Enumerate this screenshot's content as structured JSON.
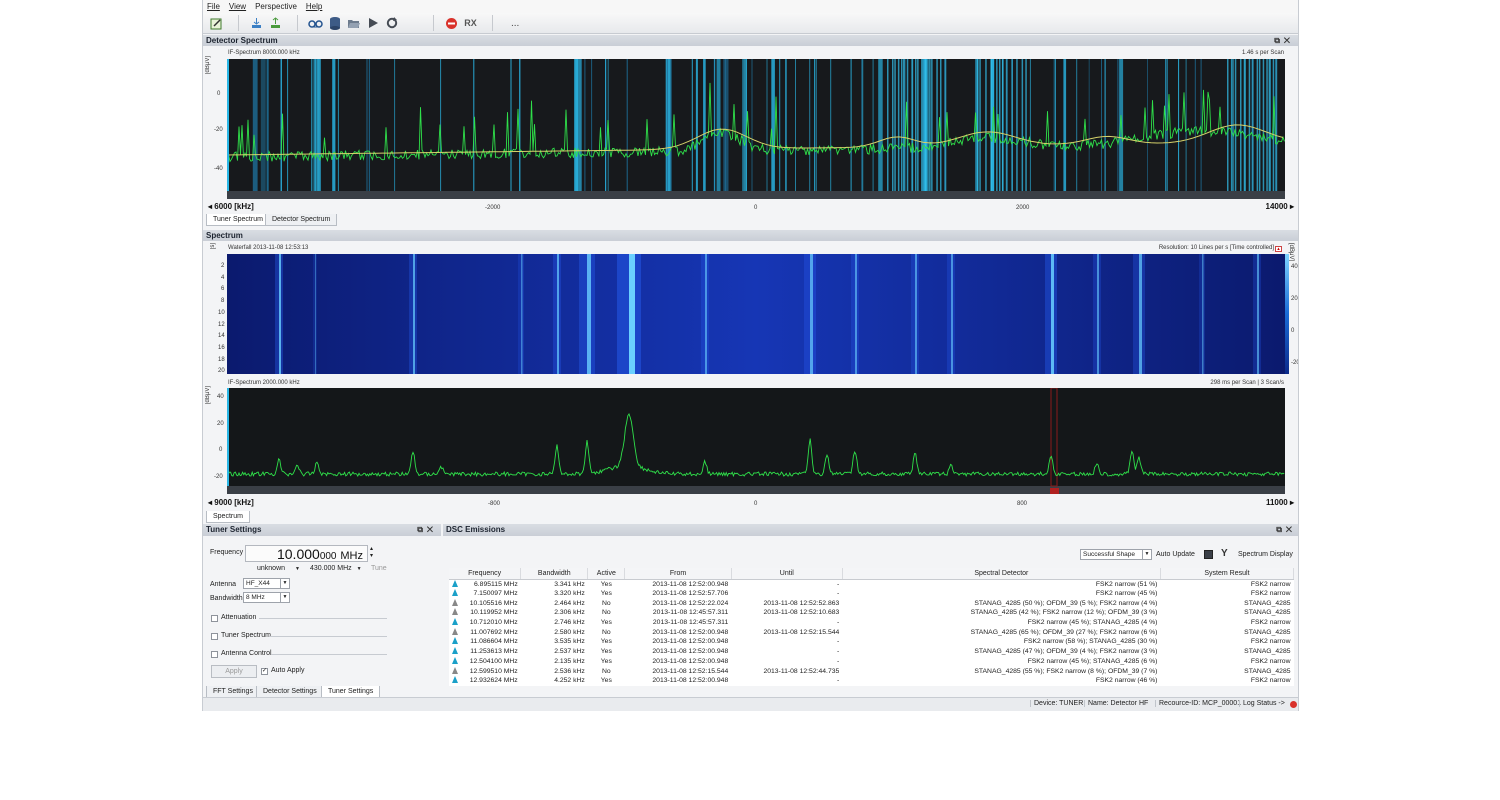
{
  "menu": [
    "File",
    "View",
    "Perspective",
    "Help"
  ],
  "toolbar": {
    "rx_label": "RX",
    "more": "..."
  },
  "detector": {
    "title": "Detector Spectrum",
    "if_label": "IF-Spectrum 8000.000 kHz",
    "rate": "1.46 s per Scan",
    "unit": "[dBμV]",
    "y_ticks": [
      "0",
      "-20",
      "-40"
    ],
    "x_ticks": [
      "-2000",
      "0",
      "2000"
    ],
    "range_start": "6000 [kHz]",
    "range_end": "14000",
    "tabs": [
      "Tuner Spectrum",
      "Detector Spectrum"
    ]
  },
  "spectrum": {
    "title": "Spectrum",
    "waterfall_label": "Waterfall 2013-11-08 12:53:13",
    "resolution": "Resolution: 10 Lines per s [Time controlled]",
    "wf_left_unit": "[s]",
    "wf_right_unit": "[dBμV]",
    "wf_y_ticks": [
      "2",
      "4",
      "6",
      "8",
      "10",
      "12",
      "14",
      "16",
      "18",
      "20"
    ],
    "wf_right_ticks": [
      "40",
      "20",
      "0",
      "-20"
    ],
    "if_label": "IF-Spectrum 2000.000 kHz",
    "rate": "298 ms per Scan | 3 Scan/s",
    "unit": "[dBμV]",
    "y_ticks": [
      "40",
      "20",
      "0",
      "-20"
    ],
    "x_ticks": [
      "-800",
      "0",
      "800"
    ],
    "range_start": "9000 [kHz]",
    "range_end": "11000",
    "tab": "Spectrum"
  },
  "tuner": {
    "title": "Tuner Settings",
    "frequency_label": "Frequency",
    "frequency_main": "10.000",
    "frequency_sub": "000",
    "frequency_unit": "MHz",
    "mode": "unknown",
    "step": "430.000",
    "step_unit": "MHz",
    "tune": "Tune",
    "antenna_label": "Antenna",
    "antenna_value": "HF_X44",
    "bandwidth_label": "Bandwidth",
    "bandwidth_value": "8 MHz",
    "attenuation": "Attenuation",
    "tuner_spectrum": "Tuner Spectrum",
    "antenna_control": "Antenna Control",
    "apply": "Apply",
    "auto_apply": "Auto Apply",
    "tabs": [
      "FFT Settings",
      "Detector Settings",
      "Tuner Settings"
    ]
  },
  "dsc": {
    "title": "DSC Emissions",
    "filter": "Successful Shape",
    "auto_update": "Auto Update",
    "spectrum_display": "Spectrum Display",
    "columns": [
      "Frequency",
      "Bandwidth",
      "Active",
      "From",
      "Until",
      "Spectral Detector",
      "System Result"
    ],
    "rows": [
      {
        "freq": "6.895115 MHz",
        "bw": "3.341 kHz",
        "active": "Yes",
        "from": "2013-11-08 12:52:00.948",
        "until": "-",
        "detector": "FSK2 narrow (51 %)",
        "result": "FSK2 narrow"
      },
      {
        "freq": "7.150097 MHz",
        "bw": "3.320 kHz",
        "active": "Yes",
        "from": "2013-11-08 12:52:57.706",
        "until": "-",
        "detector": "FSK2 narrow (45 %)",
        "result": "FSK2 narrow"
      },
      {
        "freq": "10.105516 MHz",
        "bw": "2.464 kHz",
        "active": "No",
        "from": "2013-11-08 12:52:22.024",
        "until": "2013-11-08 12:52:52.863",
        "detector": "STANAG_4285 (50 %); OFDM_39 (5 %); FSK2 narrow (4 %)",
        "result": "STANAG_4285"
      },
      {
        "freq": "10.119952 MHz",
        "bw": "2.306 kHz",
        "active": "No",
        "from": "2013-11-08 12:45:57.311",
        "until": "2013-11-08 12:52:10.683",
        "detector": "STANAG_4285 (42 %); FSK2 narrow (12 %); OFDM_39 (3 %)",
        "result": "STANAG_4285"
      },
      {
        "freq": "10.712010 MHz",
        "bw": "2.746 kHz",
        "active": "Yes",
        "from": "2013-11-08 12:45:57.311",
        "until": "-",
        "detector": "FSK2 narrow (45 %); STANAG_4285 (4 %)",
        "result": "FSK2 narrow"
      },
      {
        "freq": "11.007692 MHz",
        "bw": "2.580 kHz",
        "active": "No",
        "from": "2013-11-08 12:52:00.948",
        "until": "2013-11-08 12:52:15.544",
        "detector": "STANAG_4285 (65 %); OFDM_39 (27 %); FSK2 narrow (6 %)",
        "result": "STANAG_4285"
      },
      {
        "freq": "11.086604 MHz",
        "bw": "3.535 kHz",
        "active": "Yes",
        "from": "2013-11-08 12:52:00.948",
        "until": "-",
        "detector": "FSK2 narrow (58 %); STANAG_4285 (30 %)",
        "result": "FSK2 narrow"
      },
      {
        "freq": "11.253613 MHz",
        "bw": "2.537 kHz",
        "active": "Yes",
        "from": "2013-11-08 12:52:00.948",
        "until": "-",
        "detector": "STANAG_4285 (47 %); OFDM_39 (4 %); FSK2 narrow (3 %)",
        "result": "STANAG_4285"
      },
      {
        "freq": "12.504100 MHz",
        "bw": "2.135 kHz",
        "active": "Yes",
        "from": "2013-11-08 12:52:00.948",
        "until": "-",
        "detector": "FSK2 narrow (45 %); STANAG_4285 (6 %)",
        "result": "FSK2 narrow"
      },
      {
        "freq": "12.599510 MHz",
        "bw": "2.536 kHz",
        "active": "No",
        "from": "2013-11-08 12:52:15.544",
        "until": "2013-11-08 12:52:44.735",
        "detector": "STANAG_4285 (55 %); FSK2 narrow (8 %); OFDM_39 (7 %)",
        "result": "STANAG_4285"
      },
      {
        "freq": "12.932624 MHz",
        "bw": "4.252 kHz",
        "active": "Yes",
        "from": "2013-11-08 12:52:00.948",
        "until": "-",
        "detector": "FSK2 narrow (46 %)",
        "result": "FSK2 narrow"
      }
    ]
  },
  "status": {
    "device": "Device: TUNER",
    "name": "Name: Detector HF",
    "resource": "Recource-ID: MCP_00001",
    "log": "Log Status ->"
  },
  "colors": {
    "trace": "#2fe04a",
    "average": "#d6d26a",
    "marker": "#2ab7e6",
    "waterfall": "#1b3fd6"
  }
}
